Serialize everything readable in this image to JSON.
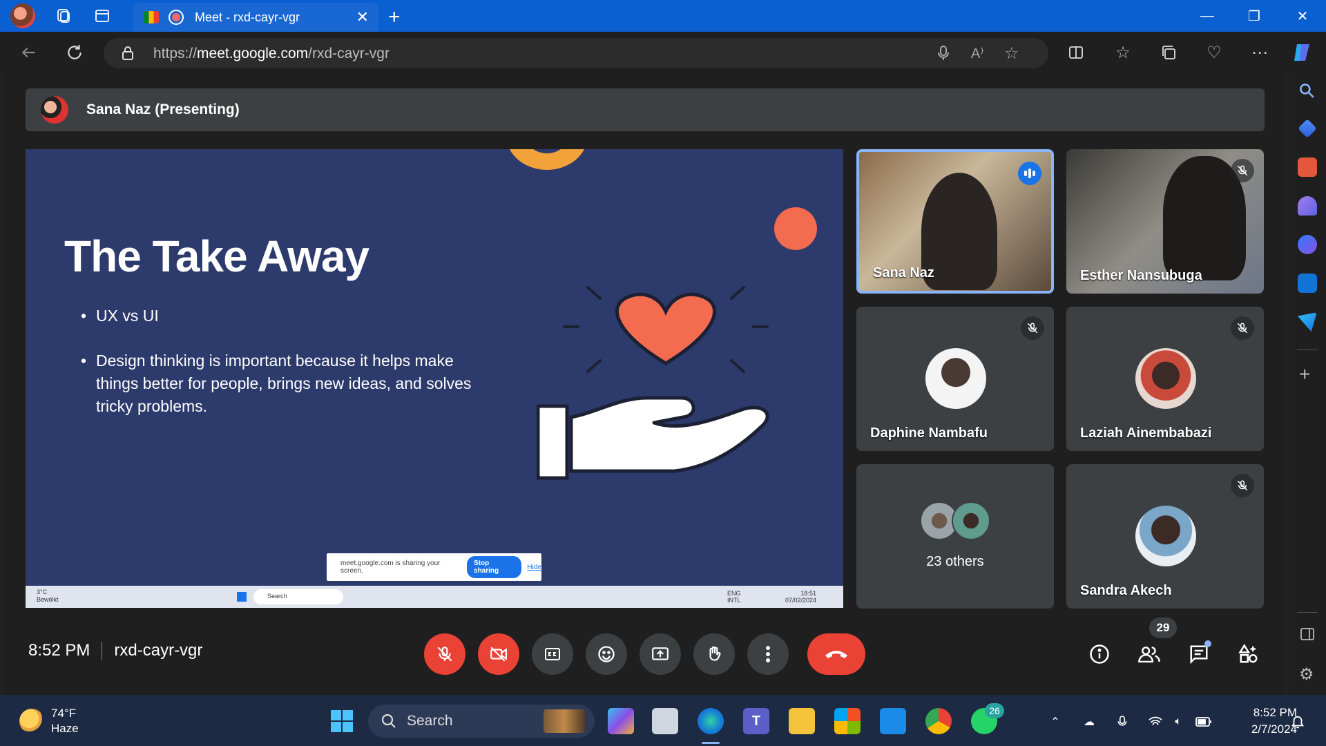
{
  "browser": {
    "tab_title": "Meet - rxd-cayr-vgr",
    "url_domain": "meet.google.com",
    "url_prefix": "https://",
    "url_path": "/rxd-cayr-vgr"
  },
  "meet": {
    "presenter_label": "Sana Naz (Presenting)",
    "time": "8:52 PM",
    "meeting_code": "rxd-cayr-vgr",
    "participant_count": "29"
  },
  "slide": {
    "title": "The Take Away",
    "bullets": [
      "UX vs UI",
      "Design thinking is important because it helps make things better for people, brings new ideas, and solves tricky problems."
    ],
    "share_notice": "meet.google.com is sharing your screen.",
    "stop_sharing": "Stop sharing",
    "hide": "Hide",
    "mini_taskbar": {
      "temp": "3°C",
      "weather": "Bewölkt",
      "search": "Search",
      "lang1": "ENG",
      "lang2": "INTL",
      "time": "18:51",
      "date": "07/02/2024"
    }
  },
  "participants": [
    {
      "name": "Sana Naz"
    },
    {
      "name": "Esther Nansubuga"
    },
    {
      "name": "Daphine Nambafu"
    },
    {
      "name": "Laziah Ainembabazi"
    },
    {
      "name": "23 others"
    },
    {
      "name": "Sandra Akech"
    }
  ],
  "taskbar": {
    "weather_temp": "74°F",
    "weather_cond": "Haze",
    "search": "Search",
    "whatsapp_badge": "26",
    "time": "8:52 PM",
    "date": "2/7/2024"
  },
  "colors": {
    "accent": "#1a73e8",
    "danger": "#ea4335",
    "slide_bg": "#2d3a6c",
    "tile_bg": "#3c4043"
  }
}
